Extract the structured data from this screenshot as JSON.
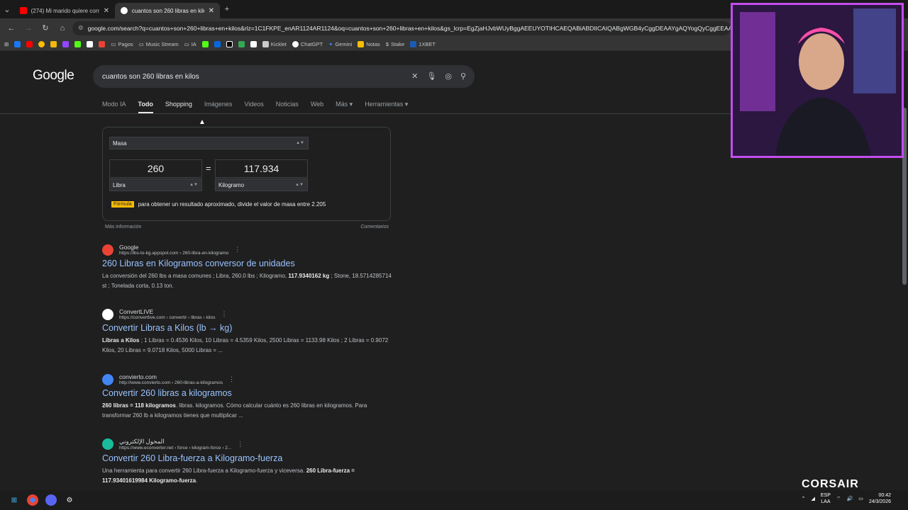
{
  "tabs": [
    {
      "label": "(274) Mi marido quiere convert",
      "active": false
    },
    {
      "label": "cuantos son 260 libras en kilos",
      "active": true
    }
  ],
  "url": "google.com/search?q=cuantos+son+260+libras+en+kilos&rlz=1C1FKPE_enAR1124AR1124&oq=cuantos+son+260+libras+en+kilos&gs_lcrp=EgZjaHJvbWUyBggAEEUYOTIHCAEQABiABDIICAIQABgWGB4yCggDEAAYgAQYogQyCggEEAAY",
  "bookmarks": [
    "Pagos",
    "Music Stream",
    "IA",
    "Kicklet",
    "ChatGPT",
    "Gemini",
    "Notas",
    "Stake",
    "1XBET"
  ],
  "logo": "Google",
  "search_query": "cuantos son 260 libras en kilos",
  "filters": [
    "Modo IA",
    "Todo",
    "Shopping",
    "Imágenes",
    "Videos",
    "Noticias",
    "Web",
    "Más ▾",
    "Herramientas ▾"
  ],
  "converter": {
    "category": "Masa",
    "from_value": "260",
    "equals": "=",
    "to_value": "117.934",
    "from_unit": "Libra",
    "to_unit": "Kilogramo",
    "formula_tag": "Fórmula",
    "formula_text": "para obtener un resultado aproximado, divide el valor de masa entre 2.205",
    "more_info": "Más información",
    "feedback": "Comentarios"
  },
  "results": [
    {
      "site": "Google",
      "url": "https://lbs-to-kg.appspot.com › 260-libra-en-kilogramo",
      "title": "260 Libras en Kilogramos conversor de unidades",
      "snippet_html": "La conversión del 260 lbs a masa comunes ; Libra, 260.0 lbs ; Kilogramo, <b>117.9340162 kg</b> ; Stone, 18.5714285714 st ; Tonelada corta, 0.13 ton.",
      "fav_color": "#ea4335"
    },
    {
      "site": "ConvertLIVE",
      "url": "https://convertlive.com › convertir › libras › kilos",
      "title": "Convertir Libras a Kilos (lb → kg)",
      "snippet_html": "<b>Libras a Kilos</b> ; 1 Libras = 0.4536 Kilos, 10 Libras = 4.5359 Kilos, 2500 Libras = 1133.98 Kilos ; 2 Libras = 0.9072 Kilos, 20 Libras = 9.0718 Kilos, 5000 Libras = ...",
      "fav_color": "#ffffff"
    },
    {
      "site": "convierto.com",
      "url": "http://www.convierto.com › 260-libras-a-kilogramos",
      "title": "Convertir 260 libras a kilogramos",
      "snippet_html": "<b>260 libras = 118 kilogramos</b>. libras. kilogramos. Cómo calcular cuánto es 260 libras en kilogramos. Para transformar 260 lb a kilogramos tienes que multiplicar ...",
      "fav_color": "#4285f4"
    },
    {
      "site": "المحول الإلكتروني",
      "url": "https://www.econverter.net › force › kilogram-force › 2...",
      "title": "Convertir 260 Libra-fuerza a Kilogramo-fuerza",
      "snippet_html": "Una herramienta para convertir 260 Libra-fuerza a Kilogramo-fuerza y viceversa. <b>260 Libra-fuerza = 117.93401619984 Kilogramo-fuerza</b>.",
      "fav_color": "#1abc9c"
    }
  ],
  "overlay": {
    "brand": "CORSAIR"
  },
  "tray": {
    "lang": "ESP",
    "lang2": "LAA",
    "time": "00:42",
    "date": "24/3/2026"
  }
}
